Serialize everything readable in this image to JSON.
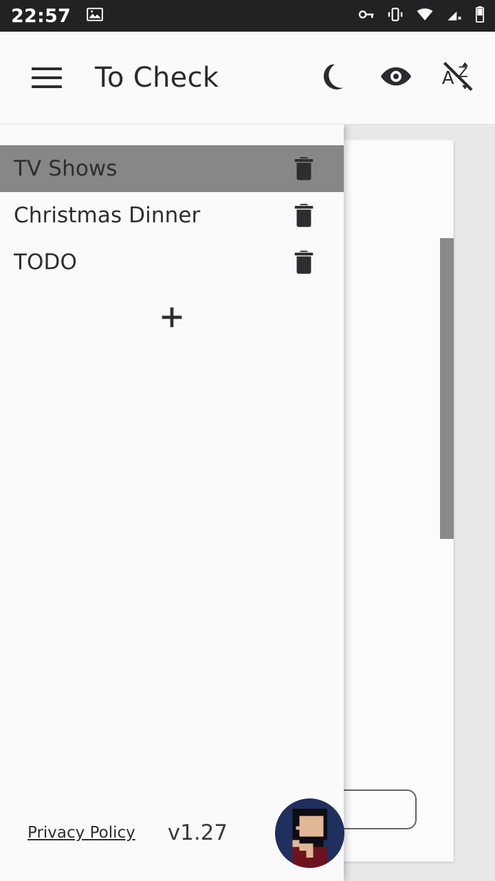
{
  "status_bar": {
    "time": "22:57",
    "left_icons": [
      "image-icon"
    ],
    "right_icons": [
      "vpn-key-icon",
      "vibrate-icon",
      "wifi-icon",
      "mobile-signal-off-icon",
      "battery-icon"
    ],
    "background_color": "#222224",
    "foreground_color": "#ffffff"
  },
  "app_bar": {
    "menu_icon": "hamburger-menu-icon",
    "title": "To Check",
    "actions": [
      {
        "icon": "moon-icon",
        "name": "dark-mode-toggle"
      },
      {
        "icon": "eye-icon",
        "name": "show-hide-checked-toggle"
      },
      {
        "icon": "sort-alpha-off-icon",
        "name": "sort-alphabetically-toggle"
      }
    ],
    "background_color": "#fafafa",
    "text_color": "#2b2b2d"
  },
  "drawer": {
    "background_color": "#fafafa",
    "selected_color": "#878787",
    "items": [
      {
        "label": "TV Shows",
        "selected": true,
        "delete_icon": "trash-icon"
      },
      {
        "label": "Christmas Dinner",
        "selected": false,
        "delete_icon": "trash-icon"
      },
      {
        "label": "TODO",
        "selected": false,
        "delete_icon": "trash-icon"
      }
    ],
    "add_button": {
      "icon": "plus-icon",
      "label": "+"
    },
    "footer": {
      "privacy_policy": "Privacy Policy",
      "version": "v1.27",
      "avatar": {
        "name": "user-avatar",
        "background_color": "#1f2f5e",
        "hair_color": "#0d0d12",
        "skin_color": "#e2b894",
        "shirt_color": "#6e1220"
      }
    }
  },
  "content": {
    "card_background": "#fbfbfb",
    "page_background": "#e8e8e8",
    "scrollbar": {
      "name": "vertical-scrollbar",
      "thumb_color": "#8a8a8a"
    },
    "partial_button": {
      "name": "partially-hidden-outline-button"
    }
  }
}
